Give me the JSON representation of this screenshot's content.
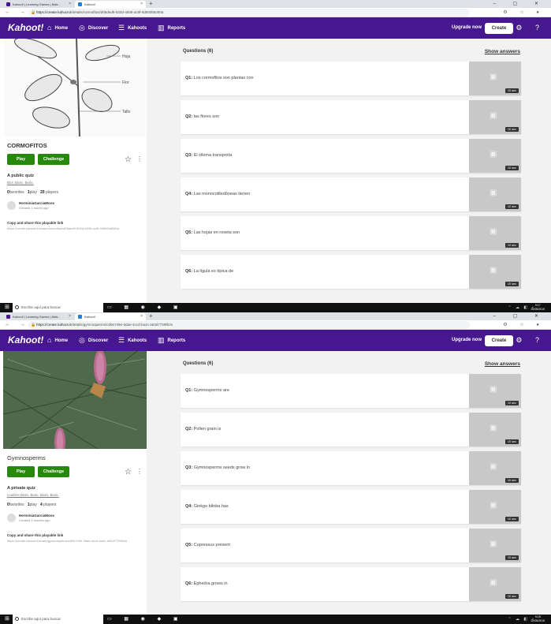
{
  "screens": [
    {
      "browser": {
        "tab1": "Kahoot! | Learning Games | Mak...",
        "tab2": "Kahoot!",
        "url_host": "https://create.kahoot.it",
        "url_path": "/details/cormofitos/d05ded9-920d-4938-ac9f-9d600b8280a"
      },
      "quiz": {
        "title": "CORMOFITOS",
        "visibility": "A public quiz",
        "language": "Biol. Biolo. Biolo.",
        "favorites": "0",
        "favorites_label": "favorites",
        "plays": "1",
        "plays_label": "play",
        "players": "20",
        "players_label": "players",
        "creator": "HerminiaGarciaMoos",
        "created": "Created 1 month ago",
        "share_label": "Copy and share this playable link",
        "share_url": "https://create.kahoot.it/share/cormofitos/d05ded9-920d-4938-ac9f-9d600b8280a"
      },
      "questions_header": "Questions (6)",
      "questions": [
        {
          "num": "Q1:",
          "text": "Los cormofitos son plantas con",
          "time": "10 sec"
        },
        {
          "num": "Q2:",
          "text": "las flores son",
          "time": "10 sec"
        },
        {
          "num": "Q3:",
          "text": "El xilema transporta",
          "time": "10 sec"
        },
        {
          "num": "Q4:",
          "text": "Las monocotiledóneas tienen",
          "time": "10 sec"
        },
        {
          "num": "Q5:",
          "text": "Las hojas en roseta son",
          "time": "10 sec"
        },
        {
          "num": "Q6:",
          "text": "La lígula es típica de",
          "time": "10 sec"
        }
      ],
      "taskbar": {
        "search": "Escribe aquí para buscar",
        "time": "9:17",
        "date": "22/05/2019"
      },
      "diagram_labels": [
        "Hoja",
        "Flor",
        "Tallo"
      ]
    },
    {
      "browser": {
        "tab1": "Kahoot! | Learning Games | Mak...",
        "tab2": "Kahoot!",
        "url_host": "https://create.kahoot.it",
        "url_path": "/details/gymnosperms/cd0e749e-3dae-4ccd-ba4c-a53d7729fbc6"
      },
      "quiz": {
        "title": "Gymnosperms",
        "visibility": "A private quiz",
        "language": "conifers Biolo. Biolo. Biolo. Biolo.",
        "favorites": "0",
        "favorites_label": "favorites",
        "plays": "1",
        "plays_label": "play",
        "players": "4",
        "players_label": "players",
        "creator": "HerminiaGarciaMoos",
        "created": "Created 2 months ago",
        "share_label": "Copy and share this playable link",
        "share_url": "https://create.kahoot.it/share/gymnosperms/cd0e749e-3dae-4ccd-ba4c-a53d7729fbc6"
      },
      "questions_header": "Questions (6)",
      "questions": [
        {
          "num": "Q1:",
          "text": "Gymnosperms are",
          "time": "10 sec"
        },
        {
          "num": "Q2:",
          "text": "Pollen grain is",
          "time": "10 sec"
        },
        {
          "num": "Q3:",
          "text": "Gymnosperms seeds grow in",
          "time": "10 sec"
        },
        {
          "num": "Q4:",
          "text": "Ginkgo biloba has",
          "time": "10 sec"
        },
        {
          "num": "Q5:",
          "text": "Cupressus present",
          "time": "10 sec"
        },
        {
          "num": "Q6:",
          "text": "Ephedra grows in",
          "time": "10 sec"
        }
      ],
      "taskbar": {
        "search": "Escribe aquí para buscar",
        "time": "9:18",
        "date": "22/05/2019"
      }
    }
  ],
  "nav": {
    "logo": "Kahoot!",
    "home": "Home",
    "discover": "Discover",
    "kahoots": "Kahoots",
    "reports": "Reports",
    "upgrade": "Upgrade now",
    "create": "Create"
  },
  "buttons": {
    "play": "Play",
    "challenge": "Challenge"
  },
  "colors": {
    "brand": "#46178f",
    "play": "#26890c"
  }
}
